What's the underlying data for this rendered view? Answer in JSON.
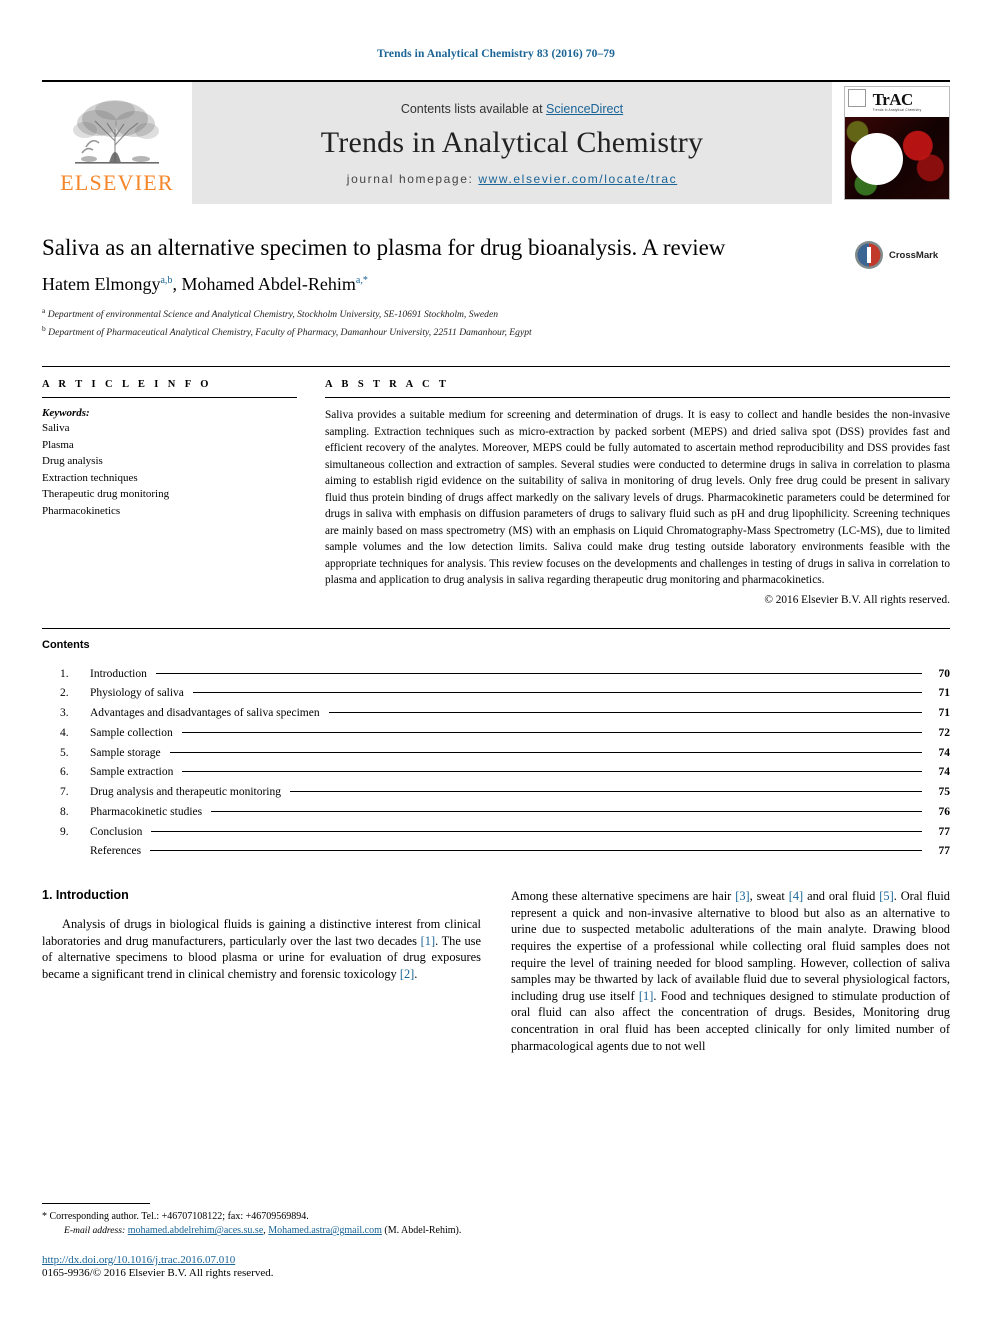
{
  "running_head": "Trends in Analytical Chemistry 83 (2016) 70–79",
  "masthead": {
    "publisher_name": "ELSEVIER",
    "contents_prefix": "Contents lists available at ",
    "sciencedirect": "ScienceDirect",
    "journal_name": "Trends in Analytical Chemistry",
    "homepage_prefix": "journal homepage: ",
    "homepage_url": "www.elsevier.com/locate/trac",
    "cover_title": "TrAC",
    "cover_subtitle": "Trends in Analytical Chemistry"
  },
  "article": {
    "title": "Saliva as an alternative specimen to plasma for drug bioanalysis. A review",
    "authors": "Hatem Elmongy a,b, Mohamed Abdel-Rehim a,*",
    "author_1_name": "Hatem Elmongy",
    "author_1_sup": "a,b",
    "author_2_name": "Mohamed Abdel-Rehim",
    "author_2_sup": "a,*",
    "affiliation_a": "Department of environmental Science and Analytical Chemistry, Stockholm University, SE-10691 Stockholm, Sweden",
    "affiliation_b": "Department of Pharmaceutical Analytical Chemistry, Faculty of Pharmacy, Damanhour University, 22511 Damanhour, Egypt",
    "crossmark_label": "CrossMark"
  },
  "article_info": {
    "heading": "A R T I C L E    I N F O",
    "keywords_label": "Keywords:",
    "keywords": [
      "Saliva",
      "Plasma",
      "Drug analysis",
      "Extraction techniques",
      "Therapeutic drug monitoring",
      "Pharmacokinetics"
    ]
  },
  "abstract": {
    "heading": "A B S T R A C T",
    "text": "Saliva provides a suitable medium for screening and determination of drugs. It is easy to collect and handle besides the non-invasive sampling. Extraction techniques such as micro-extraction by packed sorbent (MEPS) and dried saliva spot (DSS) provides fast and efficient recovery of the analytes. Moreover, MEPS could be fully automated to ascertain method reproducibility and DSS provides fast simultaneous collection and extraction of samples. Several studies were conducted to determine drugs in saliva in correlation to plasma aiming to establish rigid evidence on the suitability of saliva in monitoring of drug levels. Only free drug could be present in salivary fluid thus protein binding of drugs affect markedly on the salivary levels of drugs. Pharmacokinetic parameters could be determined for drugs in saliva with emphasis on diffusion parameters of drugs to salivary fluid such as pH and drug lipophilicity. Screening techniques are mainly based on mass spectrometry (MS) with an emphasis on Liquid Chromatography-Mass Spectrometry (LC-MS), due to limited sample volumes and the low detection limits. Saliva could make drug testing outside laboratory environments feasible with the appropriate techniques for analysis. This review focuses on the developments and challenges in testing of drugs in saliva in correlation to plasma and application to drug analysis in saliva regarding therapeutic drug monitoring and pharmacokinetics.",
    "copyright": "© 2016 Elsevier B.V. All rights reserved."
  },
  "contents": {
    "title": "Contents",
    "entries": [
      {
        "num": "1.",
        "label": "Introduction",
        "page": "70"
      },
      {
        "num": "2.",
        "label": "Physiology of saliva",
        "page": "71"
      },
      {
        "num": "3.",
        "label": "Advantages and disadvantages of saliva specimen",
        "page": "71"
      },
      {
        "num": "4.",
        "label": "Sample collection",
        "page": "72"
      },
      {
        "num": "5.",
        "label": "Sample storage",
        "page": "74"
      },
      {
        "num": "6.",
        "label": "Sample extraction",
        "page": "74"
      },
      {
        "num": "7.",
        "label": "Drug analysis and therapeutic monitoring",
        "page": "75"
      },
      {
        "num": "8.",
        "label": "Pharmacokinetic studies",
        "page": "76"
      },
      {
        "num": "9.",
        "label": "Conclusion",
        "page": "77"
      },
      {
        "num": "",
        "label": "References",
        "page": "77"
      }
    ]
  },
  "body": {
    "section_number_title": "1.  Introduction",
    "left_paragraph_part1": "Analysis of drugs in biological fluids is gaining a distinctive interest from clinical laboratories and drug manufacturers, particularly over the last two decades ",
    "ref1": "[1]",
    "left_paragraph_part2": ". The use of alternative specimens to blood plasma or urine for evaluation of drug exposures became a significant trend in clinical chemistry and forensic toxicology ",
    "ref2": "[2]",
    "left_paragraph_part3": ".",
    "right_p1": "Among these alternative specimens are hair ",
    "ref3": "[3]",
    "right_p2": ", sweat ",
    "ref4": "[4]",
    "right_p3": " and oral fluid ",
    "ref5": "[5]",
    "right_p4": ". Oral fluid represent a quick and non-invasive alternative to blood but also as an alternative to urine due to suspected metabolic adulterations of the main analyte. Drawing blood requires the expertise of a professional while collecting oral fluid samples does not require the level of training needed for blood sampling. However, collection of saliva samples may be thwarted by lack of available fluid due to several physiological factors, including drug use itself ",
    "ref6": "[1]",
    "right_p5": ". Food and techniques designed to stimulate production of oral fluid can also affect the concentration of drugs. Besides, Monitoring drug concentration in oral fluid has been accepted clinically for only limited number of pharmacological agents due to not well"
  },
  "footnote": {
    "star": "*",
    "corresponding": " Corresponding author. Tel.: +46707108122; fax: +46709569894.",
    "email_label": "E-mail address:",
    "email_1": "mohamed.abdelrehim@aces.su.se",
    "email_sep": ", ",
    "email_2": "Mohamed.astra@gmail.com",
    "email_suffix": " (M. Abdel-Rehim).",
    "doi": "http://dx.doi.org/10.1016/j.trac.2016.07.010",
    "issn": "0165-9936/© 2016 Elsevier B.V. All rights reserved."
  },
  "colors": {
    "link": "#1a6496",
    "elsevier_orange": "#f5862a",
    "masthead_gray": "#e6e6e6"
  }
}
